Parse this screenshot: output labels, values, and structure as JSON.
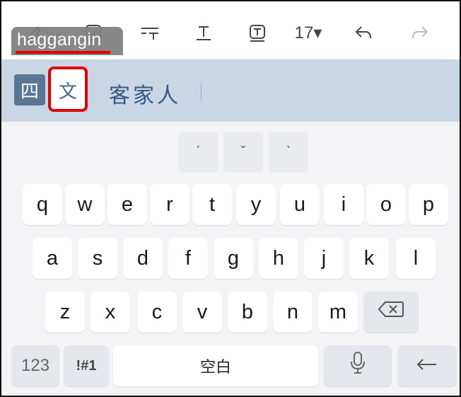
{
  "composing": {
    "text": "haggangin"
  },
  "toolbar": {
    "font_size_label": "17▾",
    "buttons": [
      "handwriting-icon",
      "select-icon",
      "text-format-icon",
      "text-style-icon",
      "text-box-icon",
      "font-size",
      "undo-icon",
      "redo-icon"
    ]
  },
  "candidate_bar": {
    "mode_si": "四",
    "mode_wen": "文",
    "candidate": "客家人"
  },
  "tone_row": [
    "ˊ",
    "ˇ",
    "ˋ"
  ],
  "keyboard": {
    "row1": [
      "q",
      "w",
      "e",
      "r",
      "t",
      "y",
      "u",
      "i",
      "o",
      "p"
    ],
    "row2": [
      "a",
      "s",
      "d",
      "f",
      "g",
      "h",
      "j",
      "k",
      "l"
    ],
    "row3": [
      "z",
      "x",
      "c",
      "v",
      "b",
      "n",
      "m"
    ],
    "numbers_key": "123",
    "symbols_key": "!#1",
    "space_key": "空白"
  },
  "colors": {
    "candidate_bar_bg": "#c9d6e6",
    "active_mode_bg": "#5b7595",
    "highlight": "#e00000",
    "composing_bg": "#7d7d7d"
  }
}
